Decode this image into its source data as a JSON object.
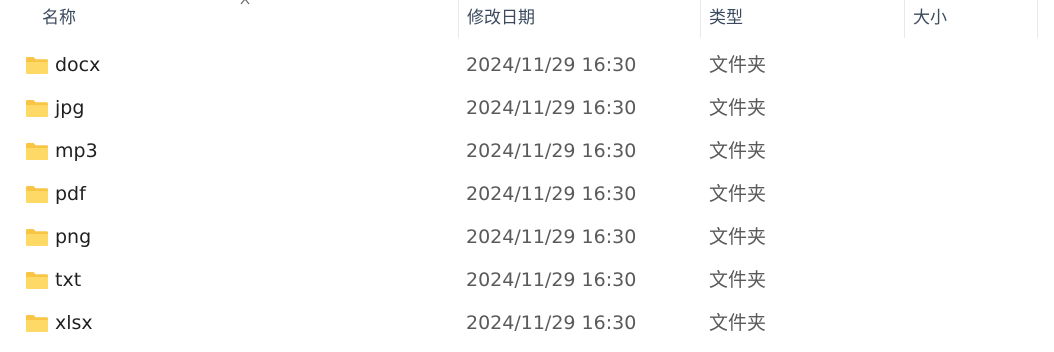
{
  "columns": {
    "name": "名称",
    "modified": "修改日期",
    "type": "类型",
    "size": "大小"
  },
  "sort_indicator": "chevron-up-icon",
  "folder_icon": "folder-icon",
  "colors": {
    "folder": "#f8c544",
    "folder_light": "#ffd966",
    "header_text": "#3b4a5e",
    "secondary_text": "#5a5a5a"
  },
  "files": [
    {
      "name": "docx",
      "modified": "2024/11/29 16:30",
      "type": "文件夹",
      "size": ""
    },
    {
      "name": "jpg",
      "modified": "2024/11/29 16:30",
      "type": "文件夹",
      "size": ""
    },
    {
      "name": "mp3",
      "modified": "2024/11/29 16:30",
      "type": "文件夹",
      "size": ""
    },
    {
      "name": "pdf",
      "modified": "2024/11/29 16:30",
      "type": "文件夹",
      "size": ""
    },
    {
      "name": "png",
      "modified": "2024/11/29 16:30",
      "type": "文件夹",
      "size": ""
    },
    {
      "name": "txt",
      "modified": "2024/11/29 16:30",
      "type": "文件夹",
      "size": ""
    },
    {
      "name": "xlsx",
      "modified": "2024/11/29 16:30",
      "type": "文件夹",
      "size": ""
    }
  ]
}
